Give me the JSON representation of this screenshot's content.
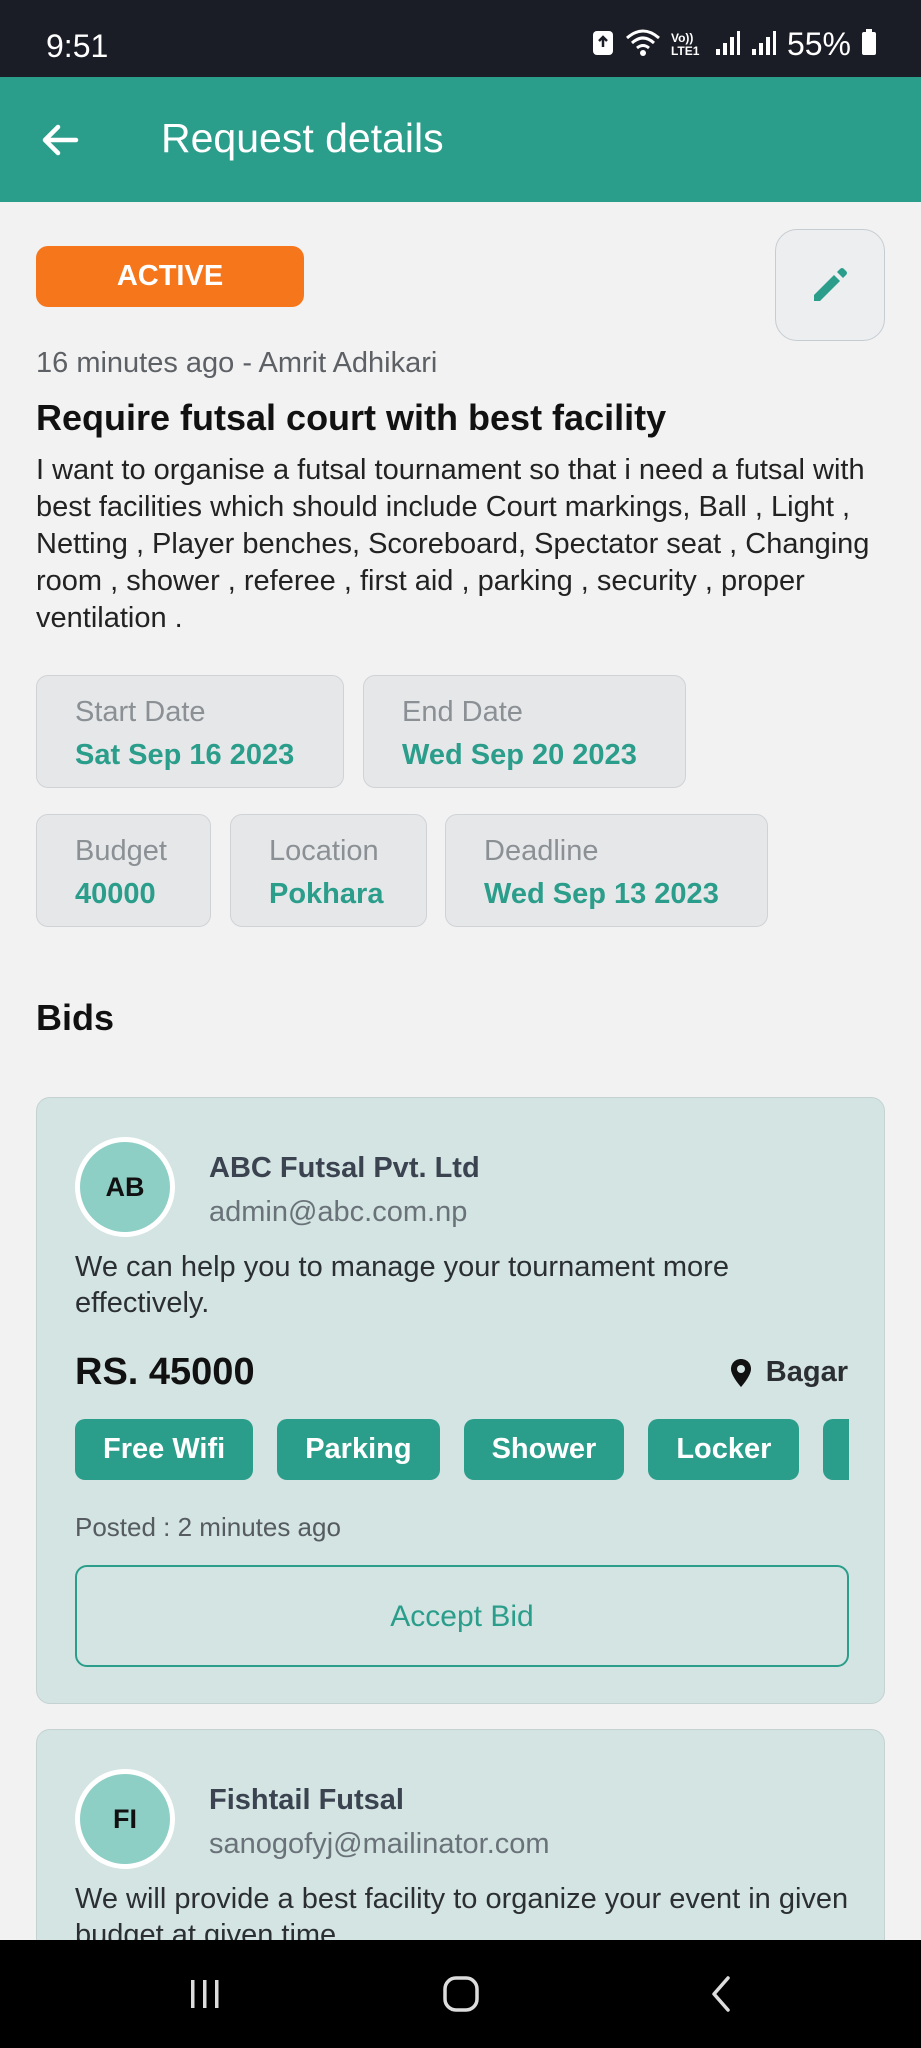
{
  "status_bar": {
    "time": "9:51",
    "network_label": "Vo)) LTE1",
    "battery_percent": "55%"
  },
  "app_bar": {
    "title": "Request details",
    "back_icon": "arrow-left-icon"
  },
  "request": {
    "status": "ACTIVE",
    "status_color": "#f6761c",
    "meta": "16 minutes ago - Amrit Adhikari",
    "title": "Require futsal court with best facility",
    "description": "I want to organise a futsal tournament so that i need a futsal with best facilities which should include Court markings, Ball , Light , Netting , Player benches, Scoreboard,  Spectator seat , Changing room , shower , referee , first aid , parking , security , proper ventilation .",
    "start_date": {
      "label": "Start Date",
      "value": "Sat Sep 16 2023"
    },
    "end_date": {
      "label": "End Date",
      "value": "Wed Sep 20 2023"
    },
    "budget": {
      "label": "Budget",
      "value": "40000"
    },
    "location": {
      "label": "Location",
      "value": "Pokhara"
    },
    "deadline": {
      "label": "Deadline",
      "value": "Wed Sep 13 2023"
    }
  },
  "bids": {
    "heading": "Bids",
    "items": [
      {
        "initials": "AB",
        "name": "ABC Futsal Pvt. Ltd",
        "email": "admin@abc.com.np",
        "message": "We can help you to manage your tournament more effectively.",
        "price": "RS. 45000",
        "location": "Bagar",
        "tags": [
          "Free Wifi",
          "Parking",
          "Shower",
          "Locker",
          ""
        ],
        "posted": "Posted : 2 minutes ago",
        "accept_label": "Accept Bid"
      },
      {
        "initials": "FI",
        "name": "Fishtail Futsal",
        "email": "sanogofyj@mailinator.com",
        "message": "We will provide a best facility to organize your event in given budget at given time."
      }
    ]
  },
  "colors": {
    "primary": "#2a9d8b",
    "status_bar": "#1b1d26",
    "card_bg": "#d3e4e2",
    "accent_orange": "#f6761c"
  }
}
